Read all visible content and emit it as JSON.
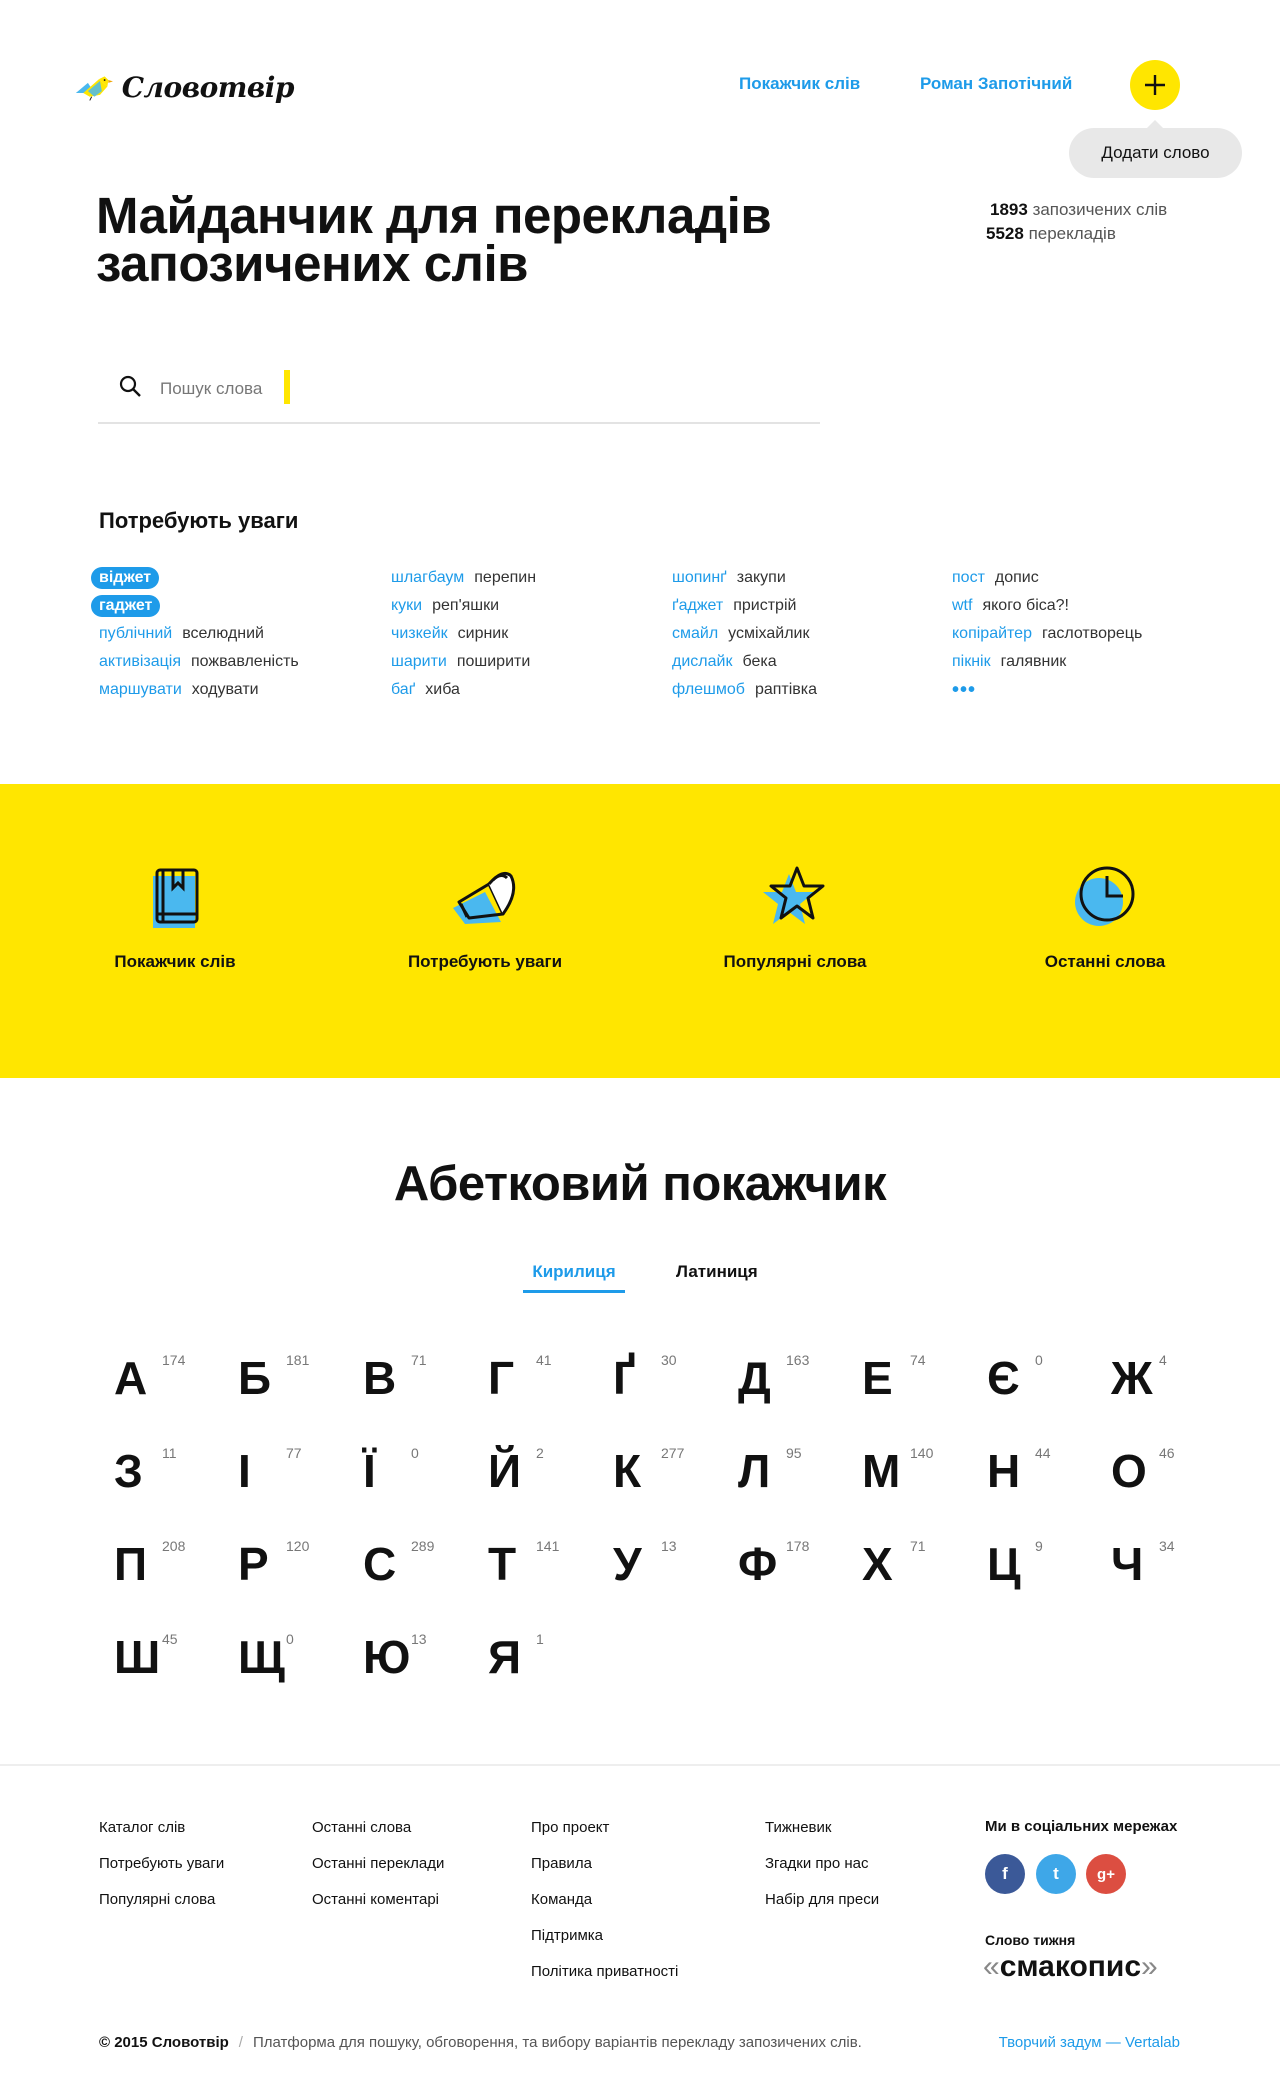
{
  "header": {
    "logo_text": "Словотвір",
    "nav": [
      "Покажчик слів",
      "Роман Запотічний"
    ],
    "add_tooltip": "Додати слово"
  },
  "hero": {
    "title_line1": "Майданчик для перекладів",
    "title_line2": "запозичених слів",
    "stats": [
      {
        "num": "1893",
        "label": "запозичених слів"
      },
      {
        "num": "5528",
        "label": "перекладів"
      }
    ]
  },
  "search": {
    "placeholder": "Пошук слова"
  },
  "attention": {
    "title": "Потребують уваги",
    "columns": [
      [
        {
          "word": "віджет",
          "trans": "",
          "highlight": true
        },
        {
          "word": "гаджет",
          "trans": "",
          "highlight": true
        },
        {
          "word": "публічний",
          "trans": "вселюдний"
        },
        {
          "word": "активізація",
          "trans": "пожвавленість"
        },
        {
          "word": "маршувати",
          "trans": "ходувати"
        }
      ],
      [
        {
          "word": "шлагбаум",
          "trans": "перепин"
        },
        {
          "word": "куки",
          "trans": "реп'яшки"
        },
        {
          "word": "чизкейк",
          "trans": "сирник"
        },
        {
          "word": "шарити",
          "trans": "поширити"
        },
        {
          "word": "баґ",
          "trans": "хиба"
        }
      ],
      [
        {
          "word": "шопинґ",
          "trans": "закупи"
        },
        {
          "word": "ґаджет",
          "trans": "пристрій"
        },
        {
          "word": "смайл",
          "trans": "усміхайлик"
        },
        {
          "word": "дислайк",
          "trans": "бека"
        },
        {
          "word": "флешмоб",
          "trans": "раптівка"
        }
      ],
      [
        {
          "word": "пост",
          "trans": "допис"
        },
        {
          "word": "wtf",
          "trans": "якого біса?!"
        },
        {
          "word": "копірайтер",
          "trans": "гаслотворець"
        },
        {
          "word": "пікнік",
          "trans": "галявник"
        }
      ]
    ],
    "more": "•••"
  },
  "features": [
    {
      "label": "Покажчик слів",
      "icon": "book-icon"
    },
    {
      "label": "Потребують уваги",
      "icon": "megaphone-icon"
    },
    {
      "label": "Популярні слова",
      "icon": "star-icon"
    },
    {
      "label": "Останні слова",
      "icon": "clock-icon"
    }
  ],
  "alphabet": {
    "title": "Абетковий покажчик",
    "tabs": [
      "Кирилиця",
      "Латиниця"
    ],
    "active_tab": "Кирилиця",
    "letters": [
      {
        "ch": "А",
        "n": "174"
      },
      {
        "ch": "Б",
        "n": "181"
      },
      {
        "ch": "В",
        "n": "71"
      },
      {
        "ch": "Г",
        "n": "41"
      },
      {
        "ch": "Ґ",
        "n": "30"
      },
      {
        "ch": "Д",
        "n": "163"
      },
      {
        "ch": "Е",
        "n": "74"
      },
      {
        "ch": "Є",
        "n": "0"
      },
      {
        "ch": "Ж",
        "n": "4"
      },
      {
        "ch": "З",
        "n": "11"
      },
      {
        "ch": "І",
        "n": "77"
      },
      {
        "ch": "Ї",
        "n": "0"
      },
      {
        "ch": "Й",
        "n": "2"
      },
      {
        "ch": "К",
        "n": "277"
      },
      {
        "ch": "Л",
        "n": "95"
      },
      {
        "ch": "М",
        "n": "140"
      },
      {
        "ch": "Н",
        "n": "44"
      },
      {
        "ch": "О",
        "n": "46"
      },
      {
        "ch": "П",
        "n": "208"
      },
      {
        "ch": "Р",
        "n": "120"
      },
      {
        "ch": "С",
        "n": "289"
      },
      {
        "ch": "Т",
        "n": "141"
      },
      {
        "ch": "У",
        "n": "13"
      },
      {
        "ch": "Ф",
        "n": "178"
      },
      {
        "ch": "Х",
        "n": "71"
      },
      {
        "ch": "Ц",
        "n": "9"
      },
      {
        "ch": "Ч",
        "n": "34"
      },
      {
        "ch": "Ш",
        "n": "45"
      },
      {
        "ch": "Щ",
        "n": "0"
      },
      {
        "ch": "Ю",
        "n": "13"
      },
      {
        "ch": "Я",
        "n": "1"
      }
    ]
  },
  "footer": {
    "columns": [
      [
        "Каталог слів",
        "Потребують уваги",
        "Популярні слова"
      ],
      [
        "Останні слова",
        "Останні переклади",
        "Останні коментарі"
      ],
      [
        "Про проект",
        "Правила",
        "Команда",
        "Підтримка",
        "Політика приватності"
      ],
      [
        "Тижневик",
        "Згадки про нас",
        "Набір для преси"
      ]
    ],
    "social_title": "Ми в соціальних мережах",
    "social": [
      {
        "name": "facebook",
        "glyph": "f",
        "color": "#3b5998"
      },
      {
        "name": "twitter",
        "glyph": "t",
        "color": "#3ea7e8"
      },
      {
        "name": "google-plus",
        "glyph": "g+",
        "color": "#dc4e41"
      }
    ],
    "word_week_title": "Слово тижня",
    "word_week": "смакопис",
    "copyright": "© 2015 Словотвір",
    "description": "Платформа для пошуку, обговорення, та вибору варіантів перекладу запозичених слів.",
    "credit": "Творчий задум — Vertalab"
  },
  "colors": {
    "accent": "#1e9be9",
    "yellow": "#ffe600"
  }
}
